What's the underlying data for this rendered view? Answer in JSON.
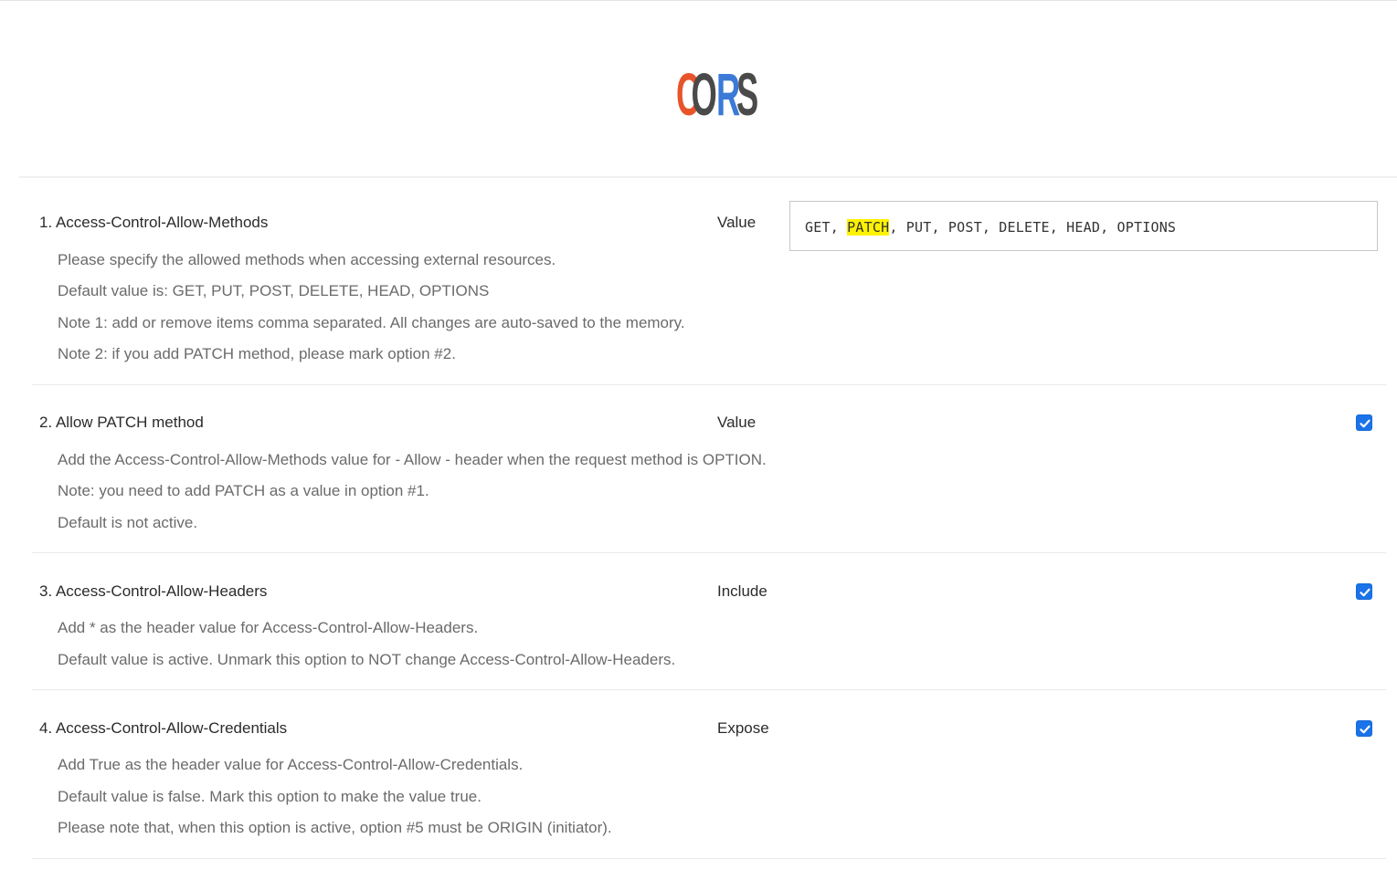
{
  "logo": {
    "alt": "CORS",
    "letters": [
      "C",
      "O",
      "R",
      "S"
    ],
    "colors": {
      "c": "#e8542a",
      "o": "#4a4a4a",
      "r": "#3b7ad6",
      "s": "#4a4a4a"
    }
  },
  "options": [
    {
      "title": "1. Access-Control-Allow-Methods",
      "col_label": "Value",
      "value_parts": [
        "GET, ",
        "PATCH",
        ", PUT, POST, DELETE, HEAD, OPTIONS"
      ],
      "lines": [
        "Please specify the allowed methods when accessing external resources.",
        "Default value is: GET, PUT, POST, DELETE, HEAD, OPTIONS",
        "Note 1: add or remove items comma separated. All changes are auto-saved to the memory.",
        "Note 2: if you add PATCH method, please mark option #2."
      ]
    },
    {
      "title": "2. Allow PATCH method",
      "col_label": "Value",
      "checked": true,
      "lines": [
        "Add the Access-Control-Allow-Methods value for - Allow - header when the request method is OPTION.",
        "Note: you need to add PATCH as a value in option #1.",
        "Default is not active."
      ]
    },
    {
      "title": "3. Access-Control-Allow-Headers",
      "col_label": "Include",
      "checked": true,
      "lines": [
        "Add * as the header value for Access-Control-Allow-Headers.",
        "Default value is active. Unmark this option to NOT change Access-Control-Allow-Headers."
      ]
    },
    {
      "title": "4. Access-Control-Allow-Credentials",
      "col_label": "Expose",
      "checked": true,
      "lines": [
        "Add True as the header value for Access-Control-Allow-Credentials.",
        "Default value is false. Mark this option to make the value true.",
        "Please note that, when this option is active, option #5 must be ORIGIN (initiator)."
      ]
    }
  ],
  "colors": {
    "accent": "#1a73e8",
    "highlight": "#fff200"
  }
}
